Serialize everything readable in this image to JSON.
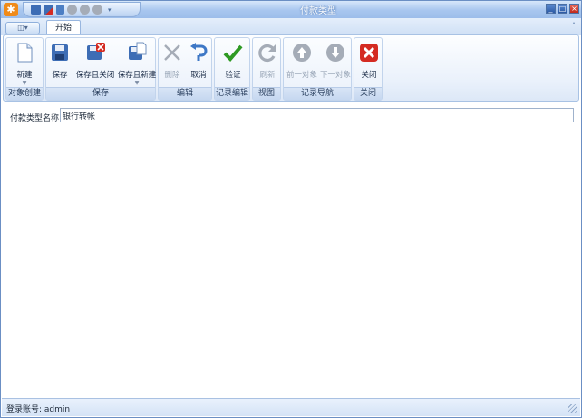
{
  "window": {
    "title": "付款类型",
    "app_icon": "gear-icon",
    "controls": {
      "minimize": "_",
      "maximize": "□",
      "close": "×"
    }
  },
  "quick_access": {
    "icons": [
      "save-icon",
      "save-close-icon",
      "undo-icon",
      "refresh-icon",
      "up-icon",
      "down-icon",
      "customize-icon"
    ],
    "customize_glyph": "▾"
  },
  "tabs": {
    "app_button": "◫▾",
    "items": [
      {
        "label": "开始"
      }
    ],
    "collapse_glyph": "˄"
  },
  "ribbon": {
    "groups": [
      {
        "label": "对象创建",
        "buttons": [
          {
            "label": "新建",
            "icon": "new-document-icon",
            "enabled": true,
            "dropdown": true
          }
        ]
      },
      {
        "label": "保存",
        "buttons": [
          {
            "label": "保存",
            "icon": "save-icon",
            "enabled": true
          },
          {
            "label": "保存且关闭",
            "icon": "save-and-close-icon",
            "enabled": true
          },
          {
            "label": "保存且新建",
            "icon": "save-and-new-icon",
            "enabled": true,
            "dropdown": true
          }
        ]
      },
      {
        "label": "编辑",
        "buttons": [
          {
            "label": "删除",
            "icon": "delete-icon",
            "enabled": false
          },
          {
            "label": "取消",
            "icon": "undo-icon",
            "enabled": true
          }
        ]
      },
      {
        "label": "记录编辑",
        "buttons": [
          {
            "label": "验证",
            "icon": "checkmark-icon",
            "enabled": true
          }
        ]
      },
      {
        "label": "视图",
        "buttons": [
          {
            "label": "刷新",
            "icon": "refresh-icon",
            "enabled": false
          }
        ]
      },
      {
        "label": "记录导航",
        "buttons": [
          {
            "label": "前一对象",
            "icon": "previous-icon",
            "enabled": false
          },
          {
            "label": "下一对象",
            "icon": "next-icon",
            "enabled": false
          }
        ]
      },
      {
        "label": "关闭",
        "buttons": [
          {
            "label": "关闭",
            "icon": "close-icon",
            "enabled": true
          }
        ]
      }
    ]
  },
  "form": {
    "name_label": "付款类型名称:",
    "name_value": "银行转帐"
  },
  "status": {
    "login_text": "登录账号: admin"
  },
  "colors": {
    "titlebar": "#a8c6ef",
    "ribbon_bg": "#eaf1fb",
    "save_blue": "#3d6db5",
    "check_green": "#2e9a23",
    "close_red": "#d42b22",
    "disabled_gray": "#a5acb7"
  }
}
